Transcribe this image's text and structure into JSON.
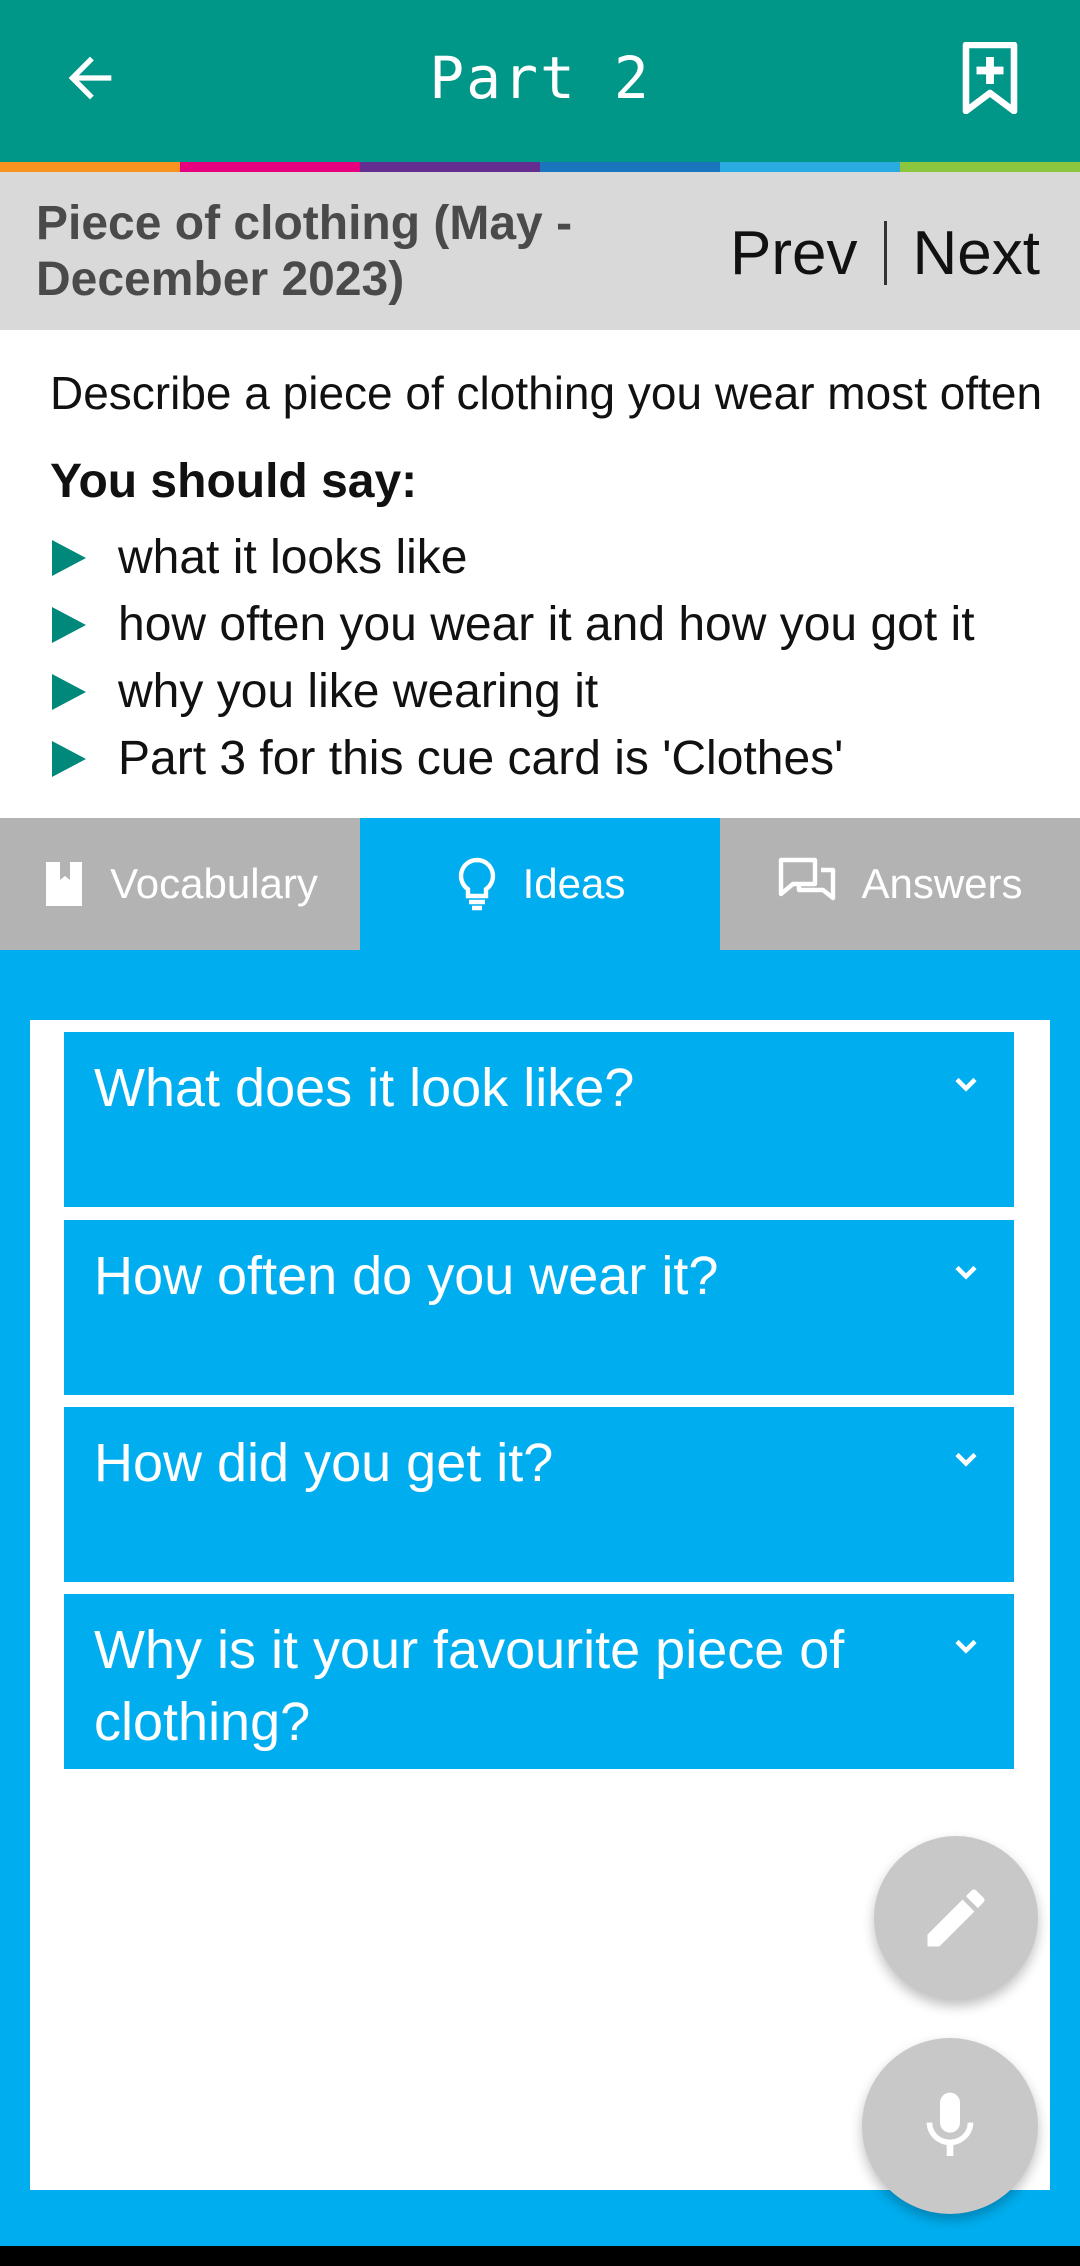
{
  "appbar": {
    "title": "Part 2",
    "back_icon": "arrow-left-icon",
    "bookmark_icon": "bookmark-plus-icon",
    "color": "#009688",
    "strip_colors": [
      "#F7931E",
      "#E6007E",
      "#662D91",
      "#1B75BC",
      "#29ABE2",
      "#8CC63F"
    ]
  },
  "subheader": {
    "topic": "Piece of clothing (May - December 2023)",
    "prev_label": "Prev",
    "next_label": "Next"
  },
  "cue": {
    "description": "Describe a piece of clothing you wear most often",
    "you_should_say": "You should say:",
    "points": [
      "what it looks like",
      "how often you wear it and how you got it",
      "why you like wearing it",
      "Part 3 for this cue card is 'Clothes'"
    ]
  },
  "tabs": [
    {
      "label": "Vocabulary",
      "icon": "book-icon",
      "active": false
    },
    {
      "label": "Ideas",
      "icon": "lightbulb-icon",
      "active": true
    },
    {
      "label": "Answers",
      "icon": "chat-icon",
      "active": false
    }
  ],
  "ideas": {
    "questions": [
      "What does it look like?",
      "How often do you wear it?",
      "How did you get it?",
      "Why is it your favourite piece of clothing?"
    ]
  },
  "fabs": {
    "edit_icon": "pencil-icon",
    "mic_icon": "microphone-icon"
  }
}
